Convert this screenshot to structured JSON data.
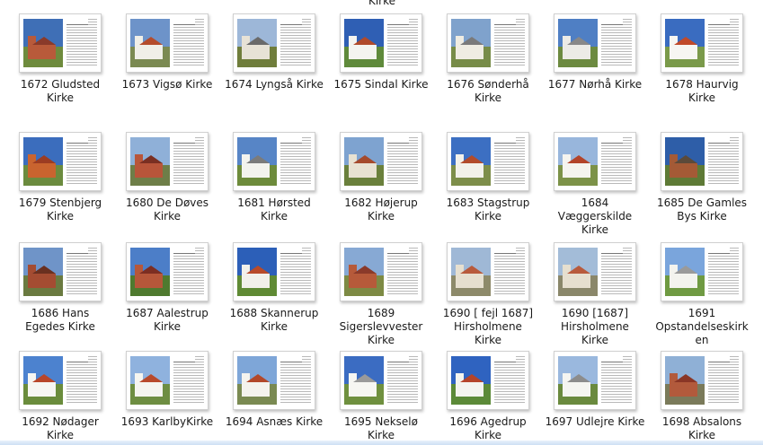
{
  "top_label": "Kirke",
  "items": [
    {
      "line1": "1672 Gludsted",
      "line2": "Kirke",
      "line3": "",
      "sky": "#3f6fb6",
      "ground": "#6e8b3d",
      "wall": "#b85a3a",
      "roof": "#8a3a2a"
    },
    {
      "line1": "1673 Vigsø Kirke",
      "line2": "",
      "line3": "",
      "sky": "#6d93c9",
      "ground": "#7b8a52",
      "wall": "#f0efe8",
      "roof": "#b44c2c"
    },
    {
      "line1": "1674 Lyngså Kirke",
      "line2": "",
      "line3": "",
      "sky": "#9db7d8",
      "ground": "#6f7d3b",
      "wall": "#e7e2d6",
      "roof": "#6a6a6a"
    },
    {
      "line1": "1675 Sindal Kirke",
      "line2": "",
      "line3": "",
      "sky": "#2f5fb4",
      "ground": "#5f8a3b",
      "wall": "#f4f4f0",
      "roof": "#b04a2b"
    },
    {
      "line1": "1676 Sønderhå",
      "line2": "Kirke",
      "line3": "",
      "sky": "#7fa2cc",
      "ground": "#778c48",
      "wall": "#efece2",
      "roof": "#7a7a7a"
    },
    {
      "line1": "1677 Nørhå Kirke",
      "line2": "",
      "line3": "",
      "sky": "#4f7fc4",
      "ground": "#6c8a40",
      "wall": "#ecebe6",
      "roof": "#888888"
    },
    {
      "line1": "1678 Haurvig",
      "line2": "Kirke",
      "line3": "",
      "sky": "#3a6cc0",
      "ground": "#7a9a4a",
      "wall": "#f6f6f2",
      "roof": "#c04a2a"
    },
    {
      "line1": "1679 Stenbjerg",
      "line2": "Kirke",
      "line3": "",
      "sky": "#3b6dbd",
      "ground": "#6b8b3e",
      "wall": "#c9642f",
      "roof": "#9c3c22"
    },
    {
      "line1": "1680 De Døves",
      "line2": "Kirke",
      "line3": "",
      "sky": "#8fb0d8",
      "ground": "#6e7e48",
      "wall": "#b8553a",
      "roof": "#7a2f22"
    },
    {
      "line1": "1681 Hørsted",
      "line2": "Kirke",
      "line3": "",
      "sky": "#5785c6",
      "ground": "#6d8b3b",
      "wall": "#f3f3ee",
      "roof": "#7b7b7b"
    },
    {
      "line1": "1682 Højerup",
      "line2": "Kirke",
      "line3": "",
      "sky": "#7ea3d0",
      "ground": "#6a803c",
      "wall": "#e8e2d2",
      "roof": "#a54a2c"
    },
    {
      "line1": "1683 Stagstrup",
      "line2": "Kirke",
      "line3": "",
      "sky": "#3c6fc2",
      "ground": "#7d8e4a",
      "wall": "#f2f1ea",
      "roof": "#b24b2b"
    },
    {
      "line1": "1684",
      "line2": "Væggerskilde",
      "line3": "Kirke",
      "sky": "#98b6dc",
      "ground": "#7c9248",
      "wall": "#f5f4ef",
      "roof": "#b3442a"
    },
    {
      "line1": "1685 De Gamles",
      "line2": "Bys Kirke",
      "line3": "",
      "sky": "#2e5ea8",
      "ground": "#5e7a36",
      "wall": "#a45a36",
      "roof": "#5b4a3a"
    },
    {
      "line1": "1686 Hans",
      "line2": "Egedes Kirke",
      "line3": "",
      "sky": "#6f94c8",
      "ground": "#6a7a40",
      "wall": "#a44c32",
      "roof": "#6a3020"
    },
    {
      "line1": "1687 Aalestrup",
      "line2": "Kirke",
      "line3": "",
      "sky": "#4c7ec8",
      "ground": "#4f7a2f",
      "wall": "#b6573a",
      "roof": "#7c2e22"
    },
    {
      "line1": "1688 Skannerup",
      "line2": "Kirke",
      "line3": "",
      "sky": "#2c5fb8",
      "ground": "#5f8a34",
      "wall": "#f1f0ea",
      "roof": "#b84a2a"
    },
    {
      "line1": "1689",
      "line2": "Sigerslevvester",
      "line3": "Kirke",
      "sky": "#87a9d4",
      "ground": "#7d8a44",
      "wall": "#b65a3a",
      "roof": "#8a3a2a"
    },
    {
      "line1": "1690 [ fejl 1687]",
      "line2": "Hirsholmene",
      "line3": "Kirke",
      "sky": "#9fb8d6",
      "ground": "#8d8a6a",
      "wall": "#e6dfcf",
      "roof": "#b85a3c"
    },
    {
      "line1": "1690 [1687]",
      "line2": "Hirsholmene",
      "line3": "Kirke",
      "sky": "#a3bcd8",
      "ground": "#8a876a",
      "wall": "#e6dfcf",
      "roof": "#b85a3c"
    },
    {
      "line1": "1691",
      "line2": "Opstandelseskirk",
      "line3": "en",
      "sky": "#7aa5dc",
      "ground": "#6f9a42",
      "wall": "#f3f3ee",
      "roof": "#9a9a9a"
    },
    {
      "line1": "1692 Nødager",
      "line2": "Kirke",
      "line3": "",
      "sky": "#4c82cf",
      "ground": "#6a8c3c",
      "wall": "#f6f6f2",
      "roof": "#b8462a"
    },
    {
      "line1": "1693 KarlbyKirke",
      "line2": "",
      "line3": "",
      "sky": "#8fb2de",
      "ground": "#6e8e42",
      "wall": "#f5f5f0",
      "roof": "#b84a2c"
    },
    {
      "line1": "1694 Asnæs Kirke",
      "line2": "",
      "line3": "",
      "sky": "#7ea6d8",
      "ground": "#7a8a52",
      "wall": "#f4f3ee",
      "roof": "#b2482a"
    },
    {
      "line1": "1695 Nekselø",
      "line2": "Kirke",
      "line3": "",
      "sky": "#3b6cc2",
      "ground": "#6f903f",
      "wall": "#f6f6f2",
      "roof": "#9a9a9a"
    },
    {
      "line1": "1696 Agedrup",
      "line2": "Kirke",
      "line3": "",
      "sky": "#2f63c0",
      "ground": "#5c8a38",
      "wall": "#f4f4ef",
      "roof": "#b5442a"
    },
    {
      "line1": "1697 Udlejre Kirke",
      "line2": "",
      "line3": "",
      "sky": "#9ab8de",
      "ground": "#6a8a3e",
      "wall": "#f5f5f1",
      "roof": "#8c8c8c"
    },
    {
      "line1": "1698 Absalons",
      "line2": "Kirke",
      "line3": "",
      "sky": "#8fb0d6",
      "ground": "#7a7a5a",
      "wall": "#b25a3c",
      "roof": "#8a3626"
    }
  ]
}
